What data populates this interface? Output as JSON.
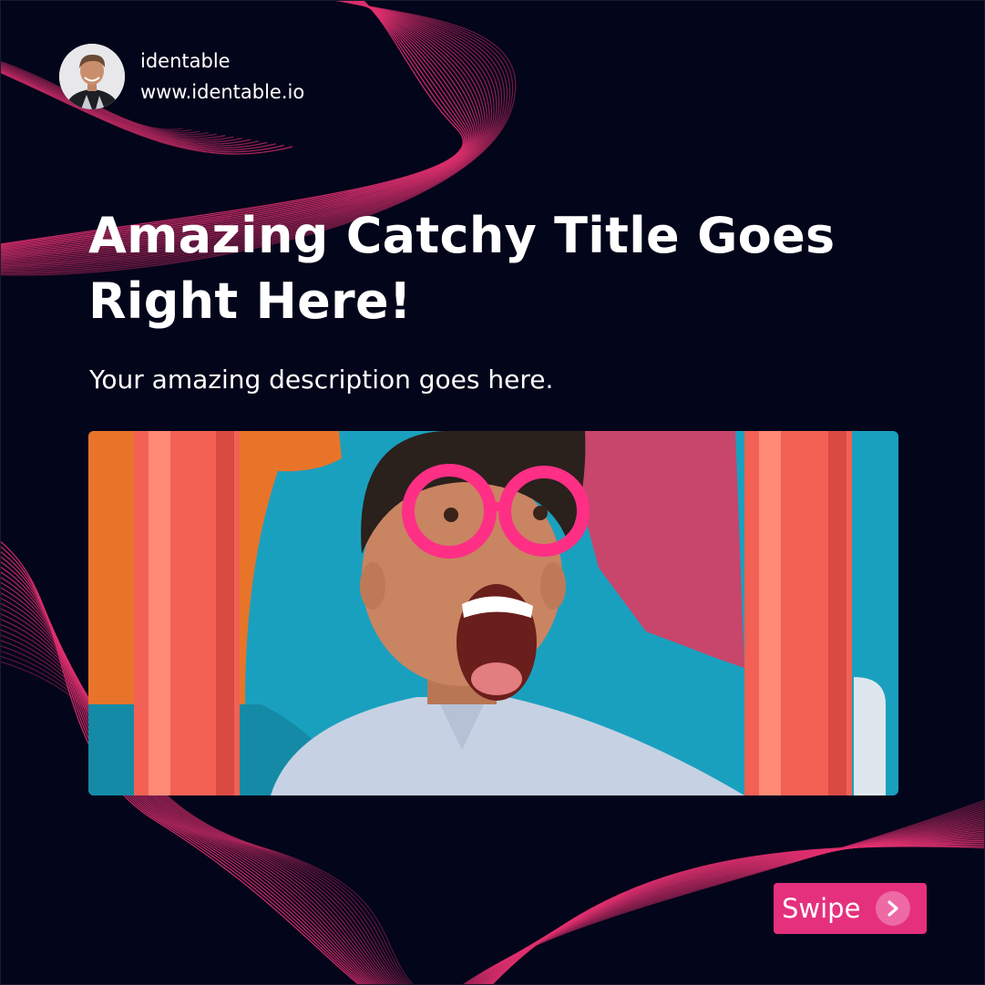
{
  "profile": {
    "name": "identable",
    "website": "www.identable.io"
  },
  "headline": {
    "title": "Amazing Catchy Title Goes Right Here!",
    "description": "Your amazing description goes here."
  },
  "cta": {
    "label": "Swipe",
    "icon": "chevron-right-icon"
  },
  "colors": {
    "background": "#03051a",
    "accent": "#e5307d",
    "accent_light": "#ee6aa5",
    "wave_lines": "#e0306f",
    "text": "#ffffff"
  }
}
